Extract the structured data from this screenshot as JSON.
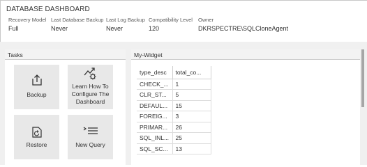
{
  "dashboard": {
    "title": "DATABASE DASHBOARD",
    "properties": [
      {
        "label": "Recovery Model",
        "value": "Full"
      },
      {
        "label": "Last Database Backup",
        "value": "Never"
      },
      {
        "label": "Last Log Backup",
        "value": "Never"
      },
      {
        "label": "Compatibility Level",
        "value": "120"
      },
      {
        "label": "Owner",
        "value": "DKRSPECTRE\\SQLCloneAgent"
      }
    ]
  },
  "tasks": {
    "title": "Tasks",
    "tiles": [
      {
        "label": "Backup",
        "icon": "backup-icon"
      },
      {
        "label": "Learn How To Configure The Dashboard",
        "icon": "chart-gear-icon"
      },
      {
        "label": "Restore",
        "icon": "restore-icon"
      },
      {
        "label": "New Query",
        "icon": "new-query-icon"
      }
    ]
  },
  "widget": {
    "title": "My-Widget",
    "columns": [
      "type_desc",
      "total_co..."
    ],
    "rows": [
      [
        "CHECK_...",
        "1"
      ],
      [
        "CLR_ST...",
        "5"
      ],
      [
        "DEFAUL...",
        "15"
      ],
      [
        "FOREIG...",
        "3"
      ],
      [
        "PRIMAR...",
        "26"
      ],
      [
        "SQL_INL...",
        "25"
      ],
      [
        "SQL_SC...",
        "13"
      ]
    ]
  }
}
